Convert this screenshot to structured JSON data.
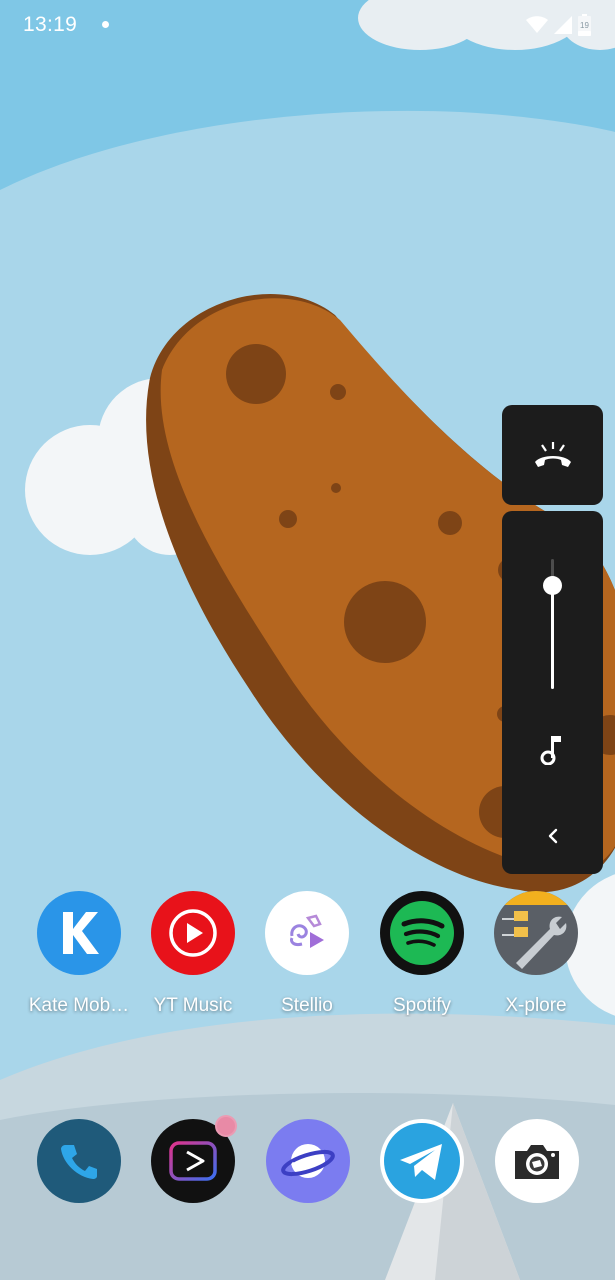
{
  "status_bar": {
    "time": "13:19",
    "battery_level": "19",
    "icons": [
      "notification-dot-icon",
      "wifi-icon",
      "cell-signal-icon",
      "battery-icon"
    ]
  },
  "volume_panel": {
    "ringer_mode": "ring",
    "media_volume_fraction": 0.8,
    "stream_icon": "music-note-icon",
    "collapse_icon": "chevron-left-icon"
  },
  "home_apps": [
    {
      "label": "Kate Mob…",
      "icon": "kate-mobile-icon",
      "color": "#2a95e8"
    },
    {
      "label": "YT Music",
      "icon": "yt-music-icon",
      "color": "#e8121a"
    },
    {
      "label": "Stellio",
      "icon": "stellio-icon",
      "color": "#ffffff"
    },
    {
      "label": "Spotify",
      "icon": "spotify-icon",
      "color": "#1db954"
    },
    {
      "label": "X-plore",
      "icon": "xplore-icon",
      "color": "#5a5f66"
    }
  ],
  "dock_apps": [
    {
      "icon": "phone-icon",
      "color": "#1f5a7a"
    },
    {
      "icon": "youtube-vanced-icon",
      "color": "#111111",
      "has_badge": true
    },
    {
      "icon": "samsung-internet-icon",
      "color": "#7b7cf0"
    },
    {
      "icon": "telegram-icon",
      "color": "#2aa3e0"
    },
    {
      "icon": "camera-icon",
      "color": "#ffffff"
    }
  ]
}
